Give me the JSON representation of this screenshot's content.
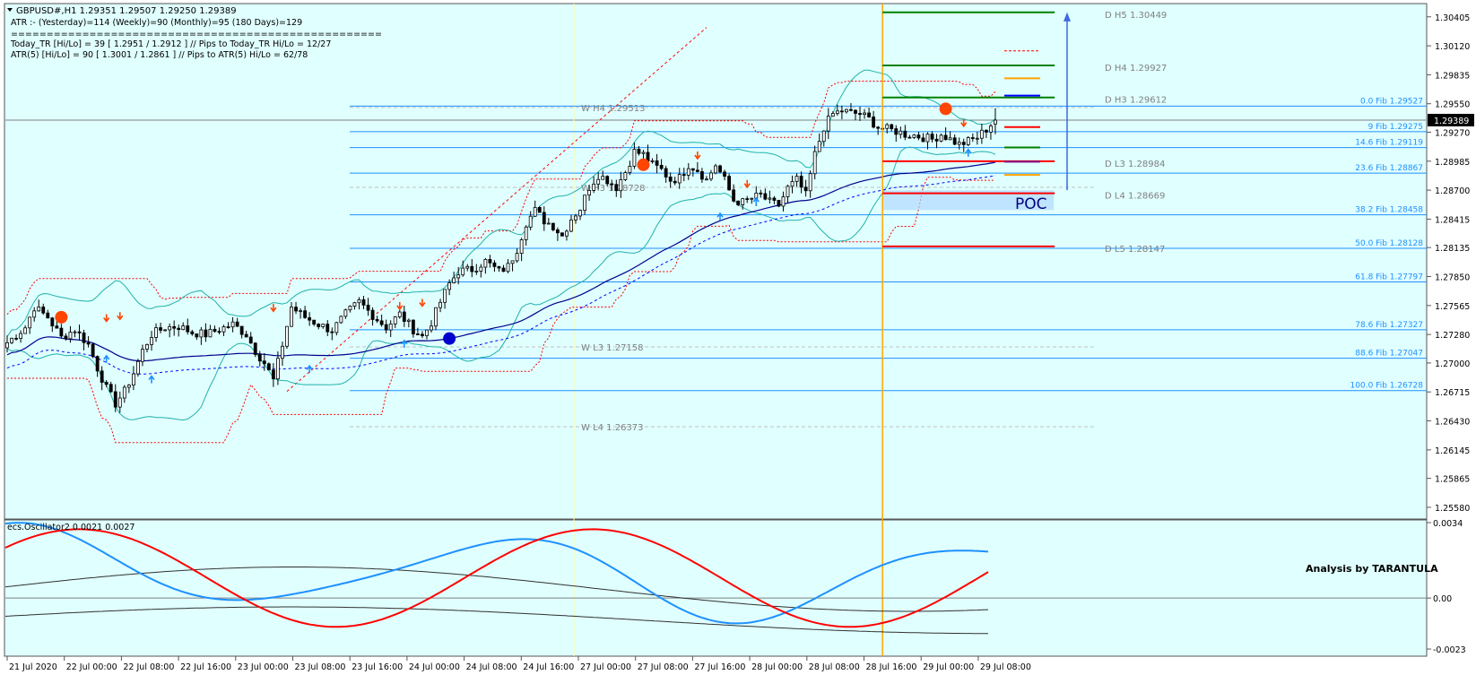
{
  "header": {
    "symbol_line": "GBPUSD#,H1  1.29351 1.29507 1.29250 1.29389",
    "atr_line": "ATR :- (Yesterday)=114       (Weekly)=90      (Monthly)=95       (180 Days)=129",
    "separator": "====================================================",
    "today_line": "Today_TR [Hi/Lo] = 39 [ 1.2951 / 1.2912 ]   // Pips to Today_TR Hi/Lo  = 12/27",
    "atr5_line": "ATR(5)      [Hi/Lo] = 90 [ 1.3001 / 1.2861 ]  //  Pips to ATR(5) Hi/Lo      = 62/78"
  },
  "oscillator": {
    "title": "ecs.Oscillator2 0.0021 0.0027",
    "watermark": "Analysis by TARANTULA",
    "axis_labels": [
      "0.0034",
      "0.00",
      "-0.0023"
    ]
  },
  "poc_label": "POC",
  "current_price": "1.29389",
  "price_axis": [
    "1.30405",
    "1.30120",
    "1.29835",
    "1.29550",
    "1.29270",
    "1.28985",
    "1.28700",
    "1.28415",
    "1.28135",
    "1.27850",
    "1.27565",
    "1.27280",
    "1.27000",
    "1.26715",
    "1.26430",
    "1.26145",
    "1.25865",
    "1.25580"
  ],
  "time_axis": [
    "21 Jul 2020",
    "22 Jul 00:00",
    "22 Jul 08:00",
    "22 Jul 16:00",
    "23 Jul 00:00",
    "23 Jul 08:00",
    "23 Jul 16:00",
    "24 Jul 00:00",
    "24 Jul 08:00",
    "24 Jul 16:00",
    "27 Jul 00:00",
    "27 Jul 08:00",
    "27 Jul 16:00",
    "28 Jul 00:00",
    "28 Jul 08:00",
    "28 Jul 16:00",
    "29 Jul 00:00",
    "29 Jul 08:00"
  ],
  "fib_labels": [
    "0.0 Fib 1.29527",
    "9 Fib 1.29275",
    "14.6 Fib 1.29119",
    "23.6 Fib 1.28867",
    "38.2 Fib 1.28458",
    "50.0 Fib 1.28128",
    "61.8 Fib 1.27797",
    "78.6 Fib 1.27327",
    "88.6 Fib 1.27047",
    "100.0 Fib 1.26728"
  ],
  "weekly_labels": [
    "W  H4 1.29513",
    "W  H3 1.28728",
    "W  L3 1.27158",
    "W  L4 1.26373"
  ],
  "daily_labels": [
    "D  H5 1.30449",
    "D  H4 1.29927",
    "D  H3 1.29612",
    "D  L3 1.28984",
    "D  L4 1.28669",
    "D  L5 1.28147"
  ],
  "chart_data": {
    "type": "candlestick",
    "symbol": "GBPUSD#",
    "timeframe": "H1",
    "ylim": [
      1.255,
      1.305
    ],
    "ohlc_last": {
      "open": 1.29351,
      "high": 1.29507,
      "low": 1.2925,
      "close": 1.29389
    },
    "close_path": [
      [
        0,
        1.272
      ],
      [
        4,
        1.2735
      ],
      [
        6,
        1.2755
      ],
      [
        9,
        1.2745
      ],
      [
        12,
        1.2725
      ],
      [
        15,
        1.2733
      ],
      [
        18,
        1.2718
      ],
      [
        20,
        1.2695
      ],
      [
        22,
        1.2675
      ],
      [
        24,
        1.266
      ],
      [
        26,
        1.2672
      ],
      [
        28,
        1.269
      ],
      [
        30,
        1.2712
      ],
      [
        32,
        1.2728
      ],
      [
        35,
        1.2735
      ],
      [
        38,
        1.2736
      ],
      [
        41,
        1.273
      ],
      [
        44,
        1.2728
      ],
      [
        47,
        1.2733
      ],
      [
        50,
        1.2738
      ],
      [
        53,
        1.2728
      ],
      [
        55,
        1.2712
      ],
      [
        57,
        1.27
      ],
      [
        59,
        1.2683
      ],
      [
        61,
        1.2718
      ],
      [
        63,
        1.2755
      ],
      [
        66,
        1.2745
      ],
      [
        69,
        1.2738
      ],
      [
        72,
        1.2732
      ],
      [
        75,
        1.2748
      ],
      [
        78,
        1.276
      ],
      [
        81,
        1.2747
      ],
      [
        84,
        1.2735
      ],
      [
        87,
        1.2748
      ],
      [
        90,
        1.2733
      ],
      [
        92,
        1.2726
      ],
      [
        94,
        1.274
      ],
      [
        96,
        1.276
      ],
      [
        98,
        1.2778
      ],
      [
        100,
        1.279
      ],
      [
        103,
        1.2792
      ],
      [
        106,
        1.28
      ],
      [
        109,
        1.279
      ],
      [
        111,
        1.2795
      ],
      [
        113,
        1.2812
      ],
      [
        115,
        1.2838
      ],
      [
        117,
        1.285
      ],
      [
        119,
        1.284
      ],
      [
        121,
        1.2835
      ],
      [
        123,
        1.2825
      ],
      [
        125,
        1.2842
      ],
      [
        127,
        1.2852
      ],
      [
        129,
        1.2873
      ],
      [
        131,
        1.2885
      ],
      [
        133,
        1.288
      ],
      [
        135,
        1.2873
      ],
      [
        137,
        1.2888
      ],
      [
        139,
        1.2908
      ],
      [
        141,
        1.2905
      ],
      [
        143,
        1.2895
      ],
      [
        145,
        1.289
      ],
      [
        147,
        1.288
      ],
      [
        149,
        1.2882
      ],
      [
        151,
        1.2895
      ],
      [
        153,
        1.289
      ],
      [
        155,
        1.288
      ],
      [
        157,
        1.2895
      ],
      [
        159,
        1.288
      ],
      [
        161,
        1.286
      ],
      [
        163,
        1.2858
      ],
      [
        165,
        1.2862
      ],
      [
        167,
        1.2865
      ],
      [
        169,
        1.2858
      ],
      [
        171,
        1.2855
      ],
      [
        173,
        1.2872
      ],
      [
        175,
        1.288
      ],
      [
        177,
        1.2865
      ],
      [
        179,
        1.2905
      ],
      [
        181,
        1.2932
      ],
      [
        183,
        1.2945
      ],
      [
        185,
        1.2948
      ],
      [
        187,
        1.2946
      ],
      [
        189,
        1.2945
      ],
      [
        191,
        1.294
      ],
      [
        193,
        1.2932
      ],
      [
        195,
        1.293
      ],
      [
        197,
        1.2928
      ],
      [
        199,
        1.2925
      ],
      [
        201,
        1.2924
      ],
      [
        203,
        1.2922
      ],
      [
        205,
        1.292
      ],
      [
        207,
        1.2925
      ],
      [
        209,
        1.292
      ],
      [
        211,
        1.2915
      ],
      [
        213,
        1.2918
      ],
      [
        215,
        1.2922
      ],
      [
        217,
        1.293
      ],
      [
        219,
        1.2939
      ]
    ],
    "fib_levels": [
      {
        "label": "0.0",
        "price": 1.29527
      },
      {
        "label": "9",
        "price": 1.29275
      },
      {
        "label": "14.6",
        "price": 1.29119
      },
      {
        "label": "23.6",
        "price": 1.28867
      },
      {
        "label": "38.2",
        "price": 1.28458
      },
      {
        "label": "50.0",
        "price": 1.28128
      },
      {
        "label": "61.8",
        "price": 1.27797
      },
      {
        "label": "78.6",
        "price": 1.27327
      },
      {
        "label": "88.6",
        "price": 1.27047
      },
      {
        "label": "100.0",
        "price": 1.26728
      }
    ],
    "weekly_pivots": [
      {
        "label": "H4",
        "price": 1.29513
      },
      {
        "label": "H3",
        "price": 1.28728
      },
      {
        "label": "L3",
        "price": 1.27158
      },
      {
        "label": "L4",
        "price": 1.26373
      }
    ],
    "daily_pivots": [
      {
        "label": "H5",
        "price": 1.30449,
        "color": "#008000"
      },
      {
        "label": "H4",
        "price": 1.29927,
        "color": "#008000"
      },
      {
        "label": "H3",
        "price": 1.29612,
        "color": "#008000"
      },
      {
        "label": "L3",
        "price": 1.28984,
        "color": "#ff0000"
      },
      {
        "label": "L4",
        "price": 1.28669,
        "color": "#ff0000"
      },
      {
        "label": "L5",
        "price": 1.28147,
        "color": "#ff0000"
      }
    ],
    "poc": {
      "price": 1.2861
    },
    "colors": {
      "background": "#e0ffff",
      "fib": "#1e90ff",
      "bollinger": "#20b2aa",
      "ma": "#00008b",
      "envelope": "#ff0000",
      "daily_separator": "#ffa500",
      "osc_blue": "#1e90ff",
      "osc_red": "#ff0000"
    }
  }
}
